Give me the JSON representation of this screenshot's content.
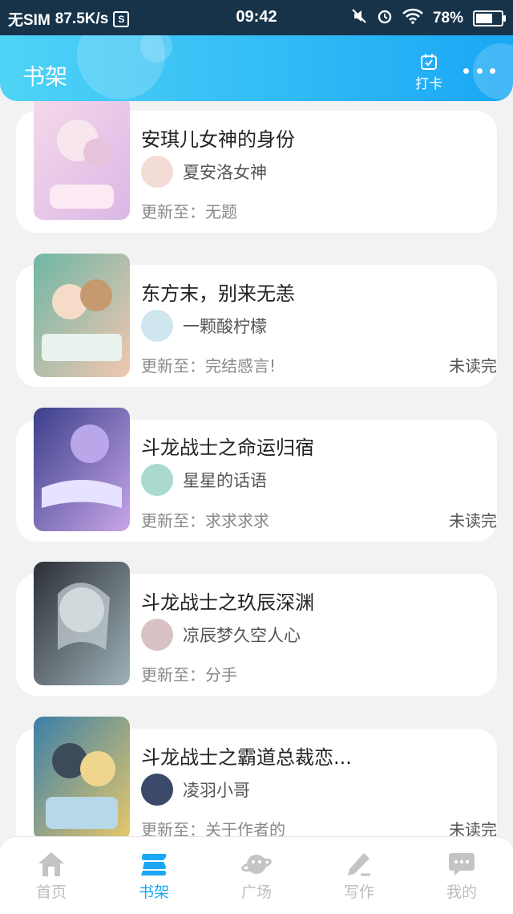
{
  "status_bar": {
    "carrier": "无SIM",
    "speed": "87.5K/s",
    "s_badge": "S",
    "time": "09:42",
    "battery": "78%",
    "battery_level": 0.78
  },
  "header": {
    "title": "书架",
    "checkin_label": "打卡",
    "more_icon": "more-dots-icon"
  },
  "books": [
    {
      "title": "安琪儿女神的身份",
      "author": "夏安洛女神",
      "update_prefix": "更新至：",
      "update": "无题",
      "status": "",
      "cover_colors": [
        "#f6d8ea",
        "#d9b8e6"
      ],
      "avatar_color": "#f3dcd6"
    },
    {
      "title": "东方末，别来无恙",
      "author": "一颗酸柠檬",
      "update_prefix": "更新至：",
      "update": "完结感言!",
      "status": "未读完",
      "cover_colors": [
        "#6fb7a5",
        "#f2c6b0"
      ],
      "avatar_color": "#cfe6ef"
    },
    {
      "title": "斗龙战士之命运归宿",
      "author": "星星的话语",
      "update_prefix": "更新至：",
      "update": "求求求求",
      "status": "未读完",
      "cover_colors": [
        "#3a3f8a",
        "#c8a6e8"
      ],
      "avatar_color": "#a9d9cf"
    },
    {
      "title": "斗龙战士之玖辰深渊",
      "author": "凉辰梦久空人心",
      "update_prefix": "更新至：",
      "update": "分手",
      "status": "",
      "cover_colors": [
        "#2b2f36",
        "#9fb2b8"
      ],
      "avatar_color": "#d8c2c4"
    },
    {
      "title": "斗龙战士之霸道总裁恋...",
      "author": "凌羽小哥",
      "update_prefix": "更新至：",
      "update": "关于作者的",
      "status": "未读完",
      "cover_colors": [
        "#3b7fa8",
        "#e8c86a"
      ],
      "avatar_color": "#3b4a6a"
    }
  ],
  "tabs": [
    {
      "label": "首页",
      "icon": "home-icon",
      "active": false
    },
    {
      "label": "书架",
      "icon": "bookshelf-icon",
      "active": true
    },
    {
      "label": "广场",
      "icon": "planet-icon",
      "active": false
    },
    {
      "label": "写作",
      "icon": "pencil-icon",
      "active": false
    },
    {
      "label": "我的",
      "icon": "chat-bubble-icon",
      "active": false
    }
  ],
  "colors": {
    "accent": "#1aa7f5",
    "header_gradient_start": "#4fd3f6",
    "status_bar_bg": "#17334a",
    "page_bg": "#f2f2f2",
    "tab_inactive": "#bdbdbd"
  }
}
